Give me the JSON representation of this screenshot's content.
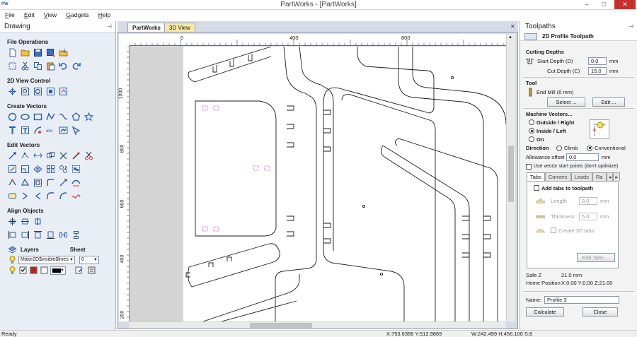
{
  "window": {
    "title": "PartWorks - [PartWorks]",
    "app_icon": "PW",
    "minimize": "–",
    "maximize": "□",
    "close": "✕"
  },
  "menu": [
    {
      "key": "F",
      "rest": "ile"
    },
    {
      "key": "E",
      "rest": "dit"
    },
    {
      "key": "V",
      "rest": "iew"
    },
    {
      "key": "G",
      "rest": "adgets"
    },
    {
      "key": "H",
      "rest": "elp"
    }
  ],
  "left_panel": {
    "title": "Drawing",
    "sections": {
      "file_operations": "File Operations",
      "view_control": "2D View Control",
      "create_vectors": "Create Vectors",
      "edit_vectors": "Edit Vectors",
      "align_objects": "Align Objects"
    },
    "layers_label": "Layers",
    "sheet_label": "Sheet",
    "layer_value": "Make2D$visible$lines",
    "sheet_value": "0"
  },
  "document": {
    "tab_active": "PartWorks",
    "tab_other": "3D View",
    "ruler_top": [
      "0",
      "400",
      "800"
    ],
    "ruler_left": [
      "1000",
      "800",
      "600",
      "400",
      "200"
    ]
  },
  "right_panel": {
    "title": "Toolpaths",
    "subtitle": "2D Profile Toolpath",
    "cutting_depths": "Cutting Depths",
    "start_depth_label": "Start Depth (D)",
    "start_depth_value": "0.0",
    "cut_depth_label": "Cut Depth (C)",
    "cut_depth_value": "15.0",
    "unit": "mm",
    "tool_label": "Tool",
    "tool_name": "End Mill (6 mm)",
    "select_button": "Select ...",
    "edit_button": "Edit ...",
    "machine_vectors": "Machine Vectors...",
    "outside_right": "Outside / Right",
    "inside_left": "Inside / Left",
    "on": "On",
    "direction": "Direction",
    "climb": "Climb",
    "conventional": "Conventional",
    "allowance_offset": "Allowance offset",
    "allowance_value": "0.0",
    "use_vector_start": "Use vector start points (don't optimize)",
    "subtabs": [
      "Tabs",
      "Corners",
      "Leads",
      "Ra"
    ],
    "add_tabs": "Add tabs to toolpath",
    "length_label": "Length",
    "length_value": "8.0",
    "thickness_label": "Thickness",
    "thickness_value": "5.0",
    "create_3d_tabs": "Create 3D tabs",
    "edit_tabs": "Edit Tabs ...",
    "safe_z_label": "Safe Z",
    "safe_z_value": "21.0 mm",
    "home_position_label": "Home Position",
    "home_position_value": "X:0.00 Y:0.00 Z:21.00",
    "name_label": "Name:",
    "name_value": "Profile 3",
    "calculate": "Calculate",
    "close": "Close"
  },
  "status": {
    "ready": "Ready",
    "cursor": "X:753.6386 Y:512.9869",
    "size": "W:242.499   H:456.100  S:6"
  },
  "colors": {
    "panel_bg": "#e9eef5",
    "tab_3d": "#f5e9a6",
    "icon_blue": "#2b5fb0",
    "selection_magenta": "#c43fa8"
  }
}
